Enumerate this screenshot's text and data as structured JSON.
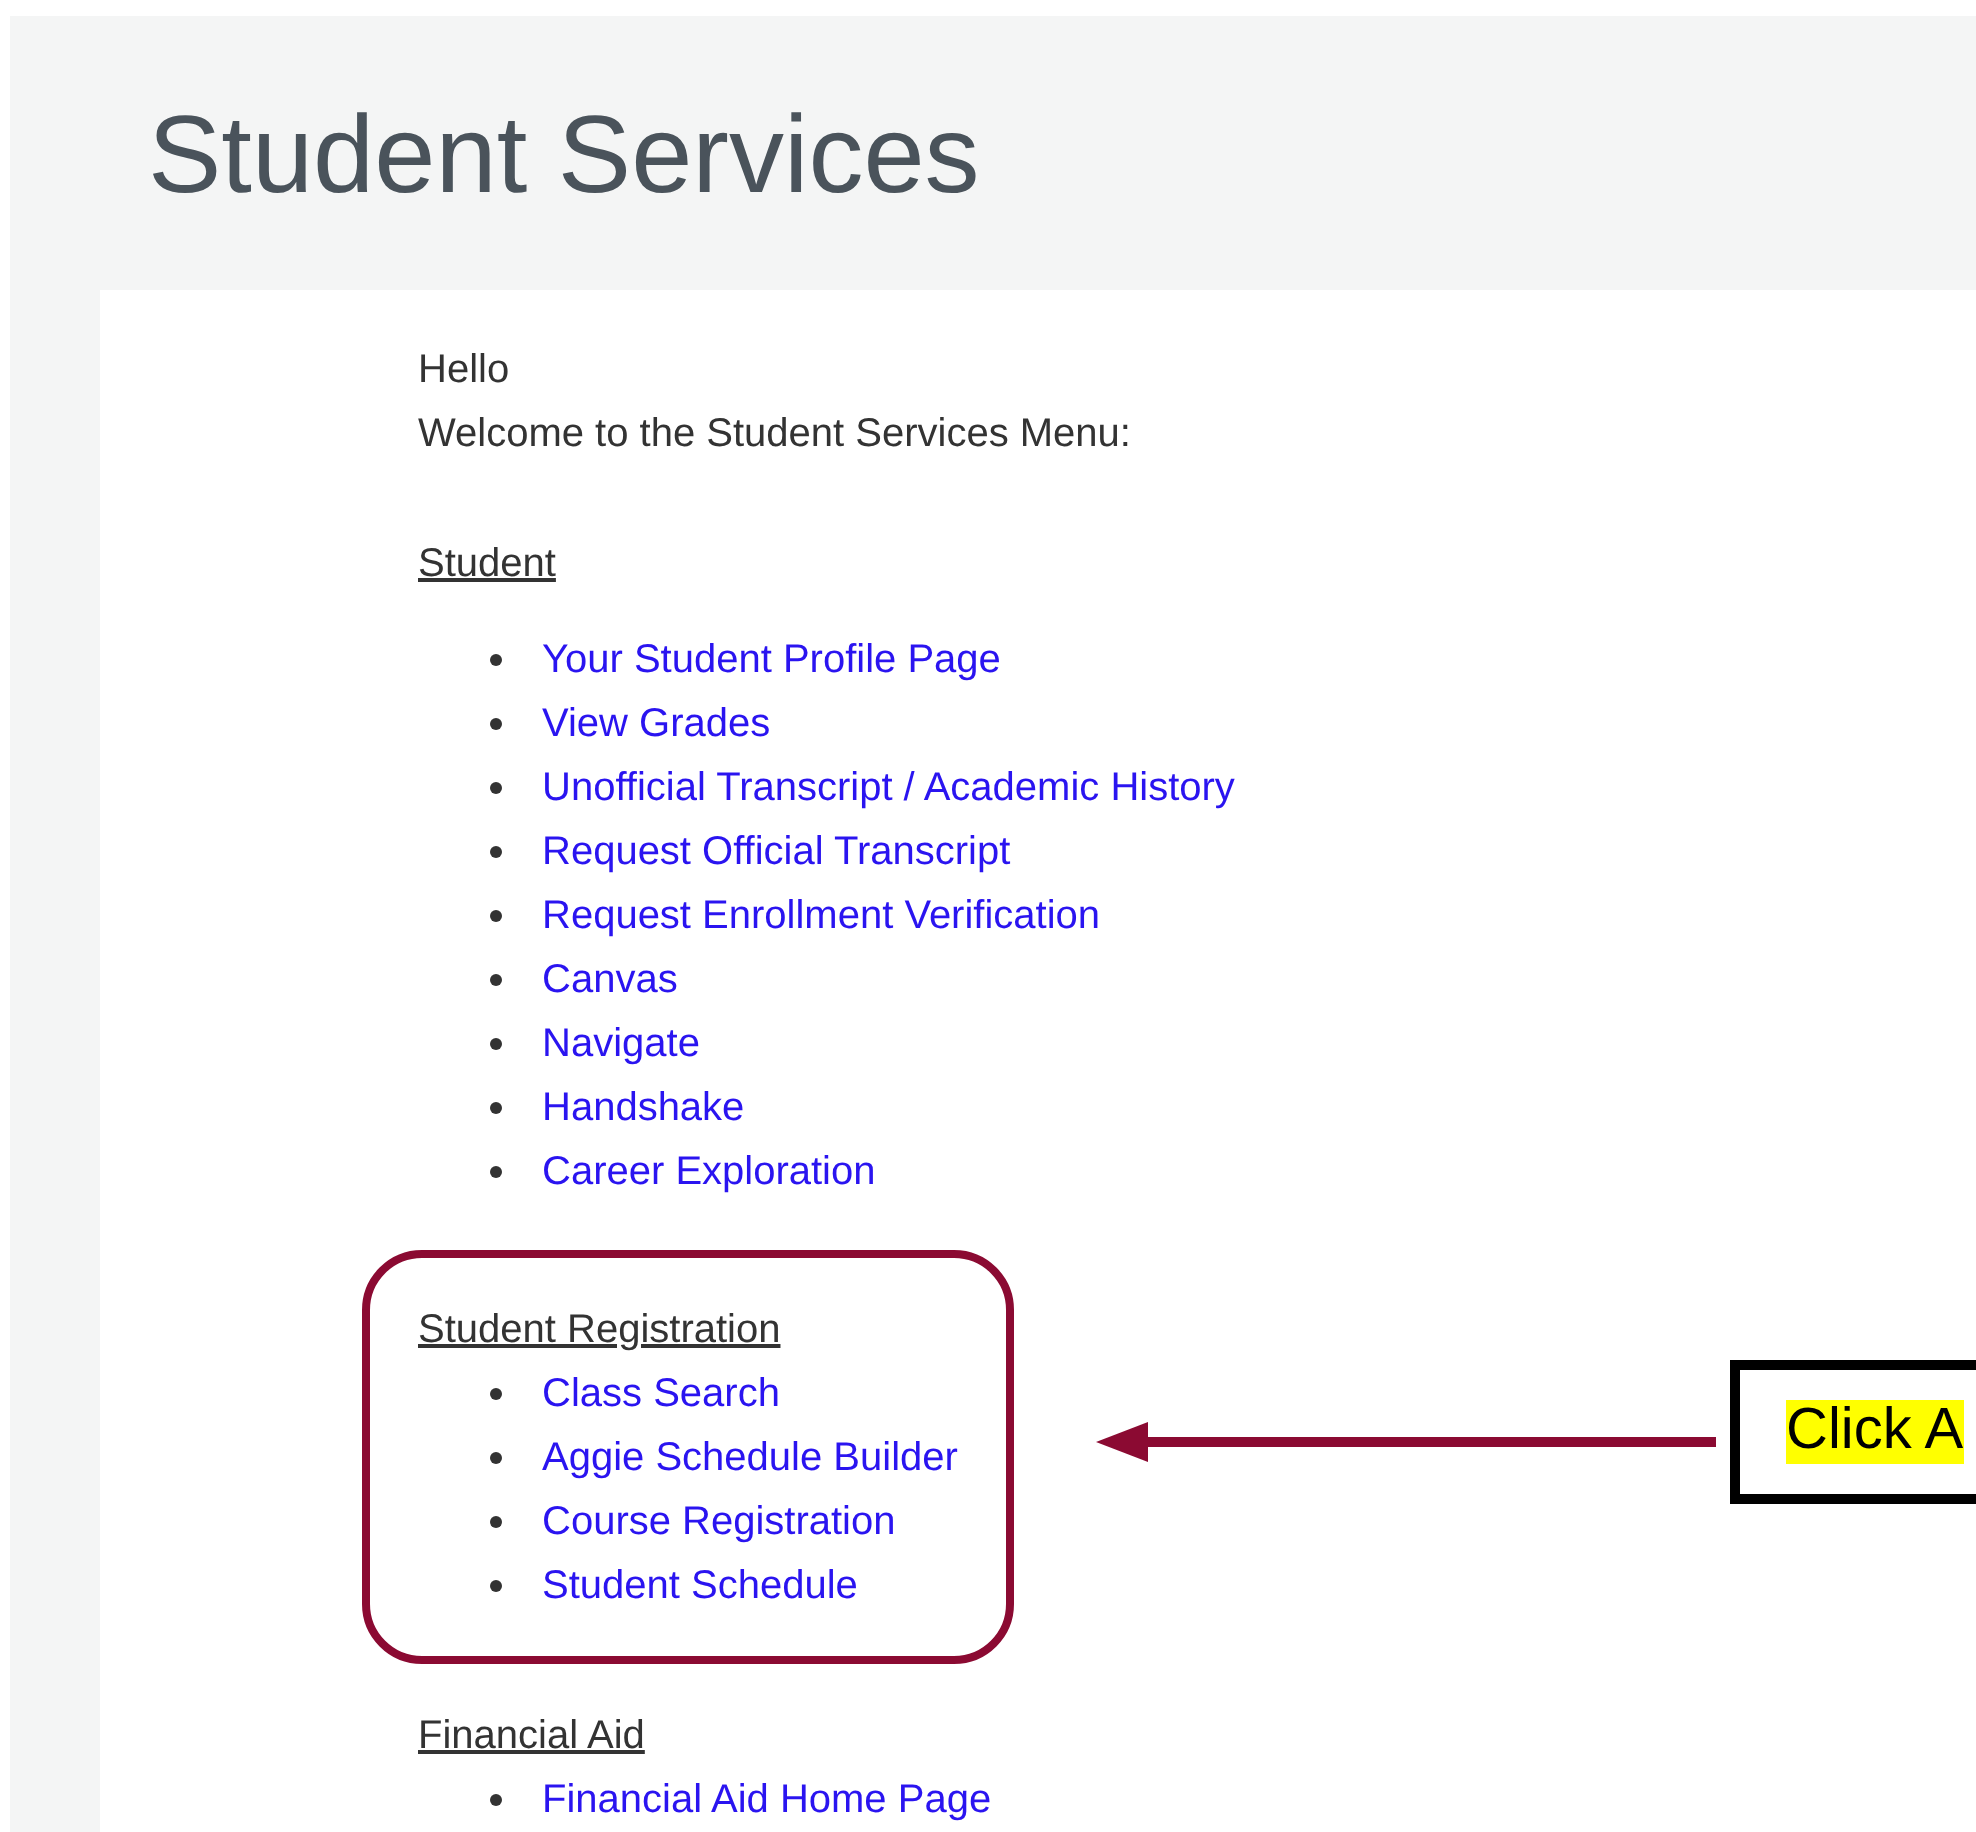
{
  "page": {
    "title": "Student Services",
    "greeting": "Hello",
    "welcome": "Welcome to the Student Services Menu:"
  },
  "sections": [
    {
      "heading": "Student",
      "highlighted": false,
      "links": [
        "Your Student Profile Page",
        "View Grades",
        "Unofficial Transcript / Academic History",
        "Request Official Transcript",
        "Request Enrollment Verification",
        "Canvas",
        "Navigate",
        "Handshake",
        "Career Exploration"
      ]
    },
    {
      "heading": "Student Registration",
      "highlighted": true,
      "links": [
        "Class Search",
        "Aggie Schedule Builder",
        "Course Registration",
        "Student Schedule"
      ]
    },
    {
      "heading": "Financial Aid",
      "highlighted": false,
      "links": [
        "Financial Aid Home Page"
      ]
    }
  ],
  "callout": {
    "text": "Click A"
  }
}
